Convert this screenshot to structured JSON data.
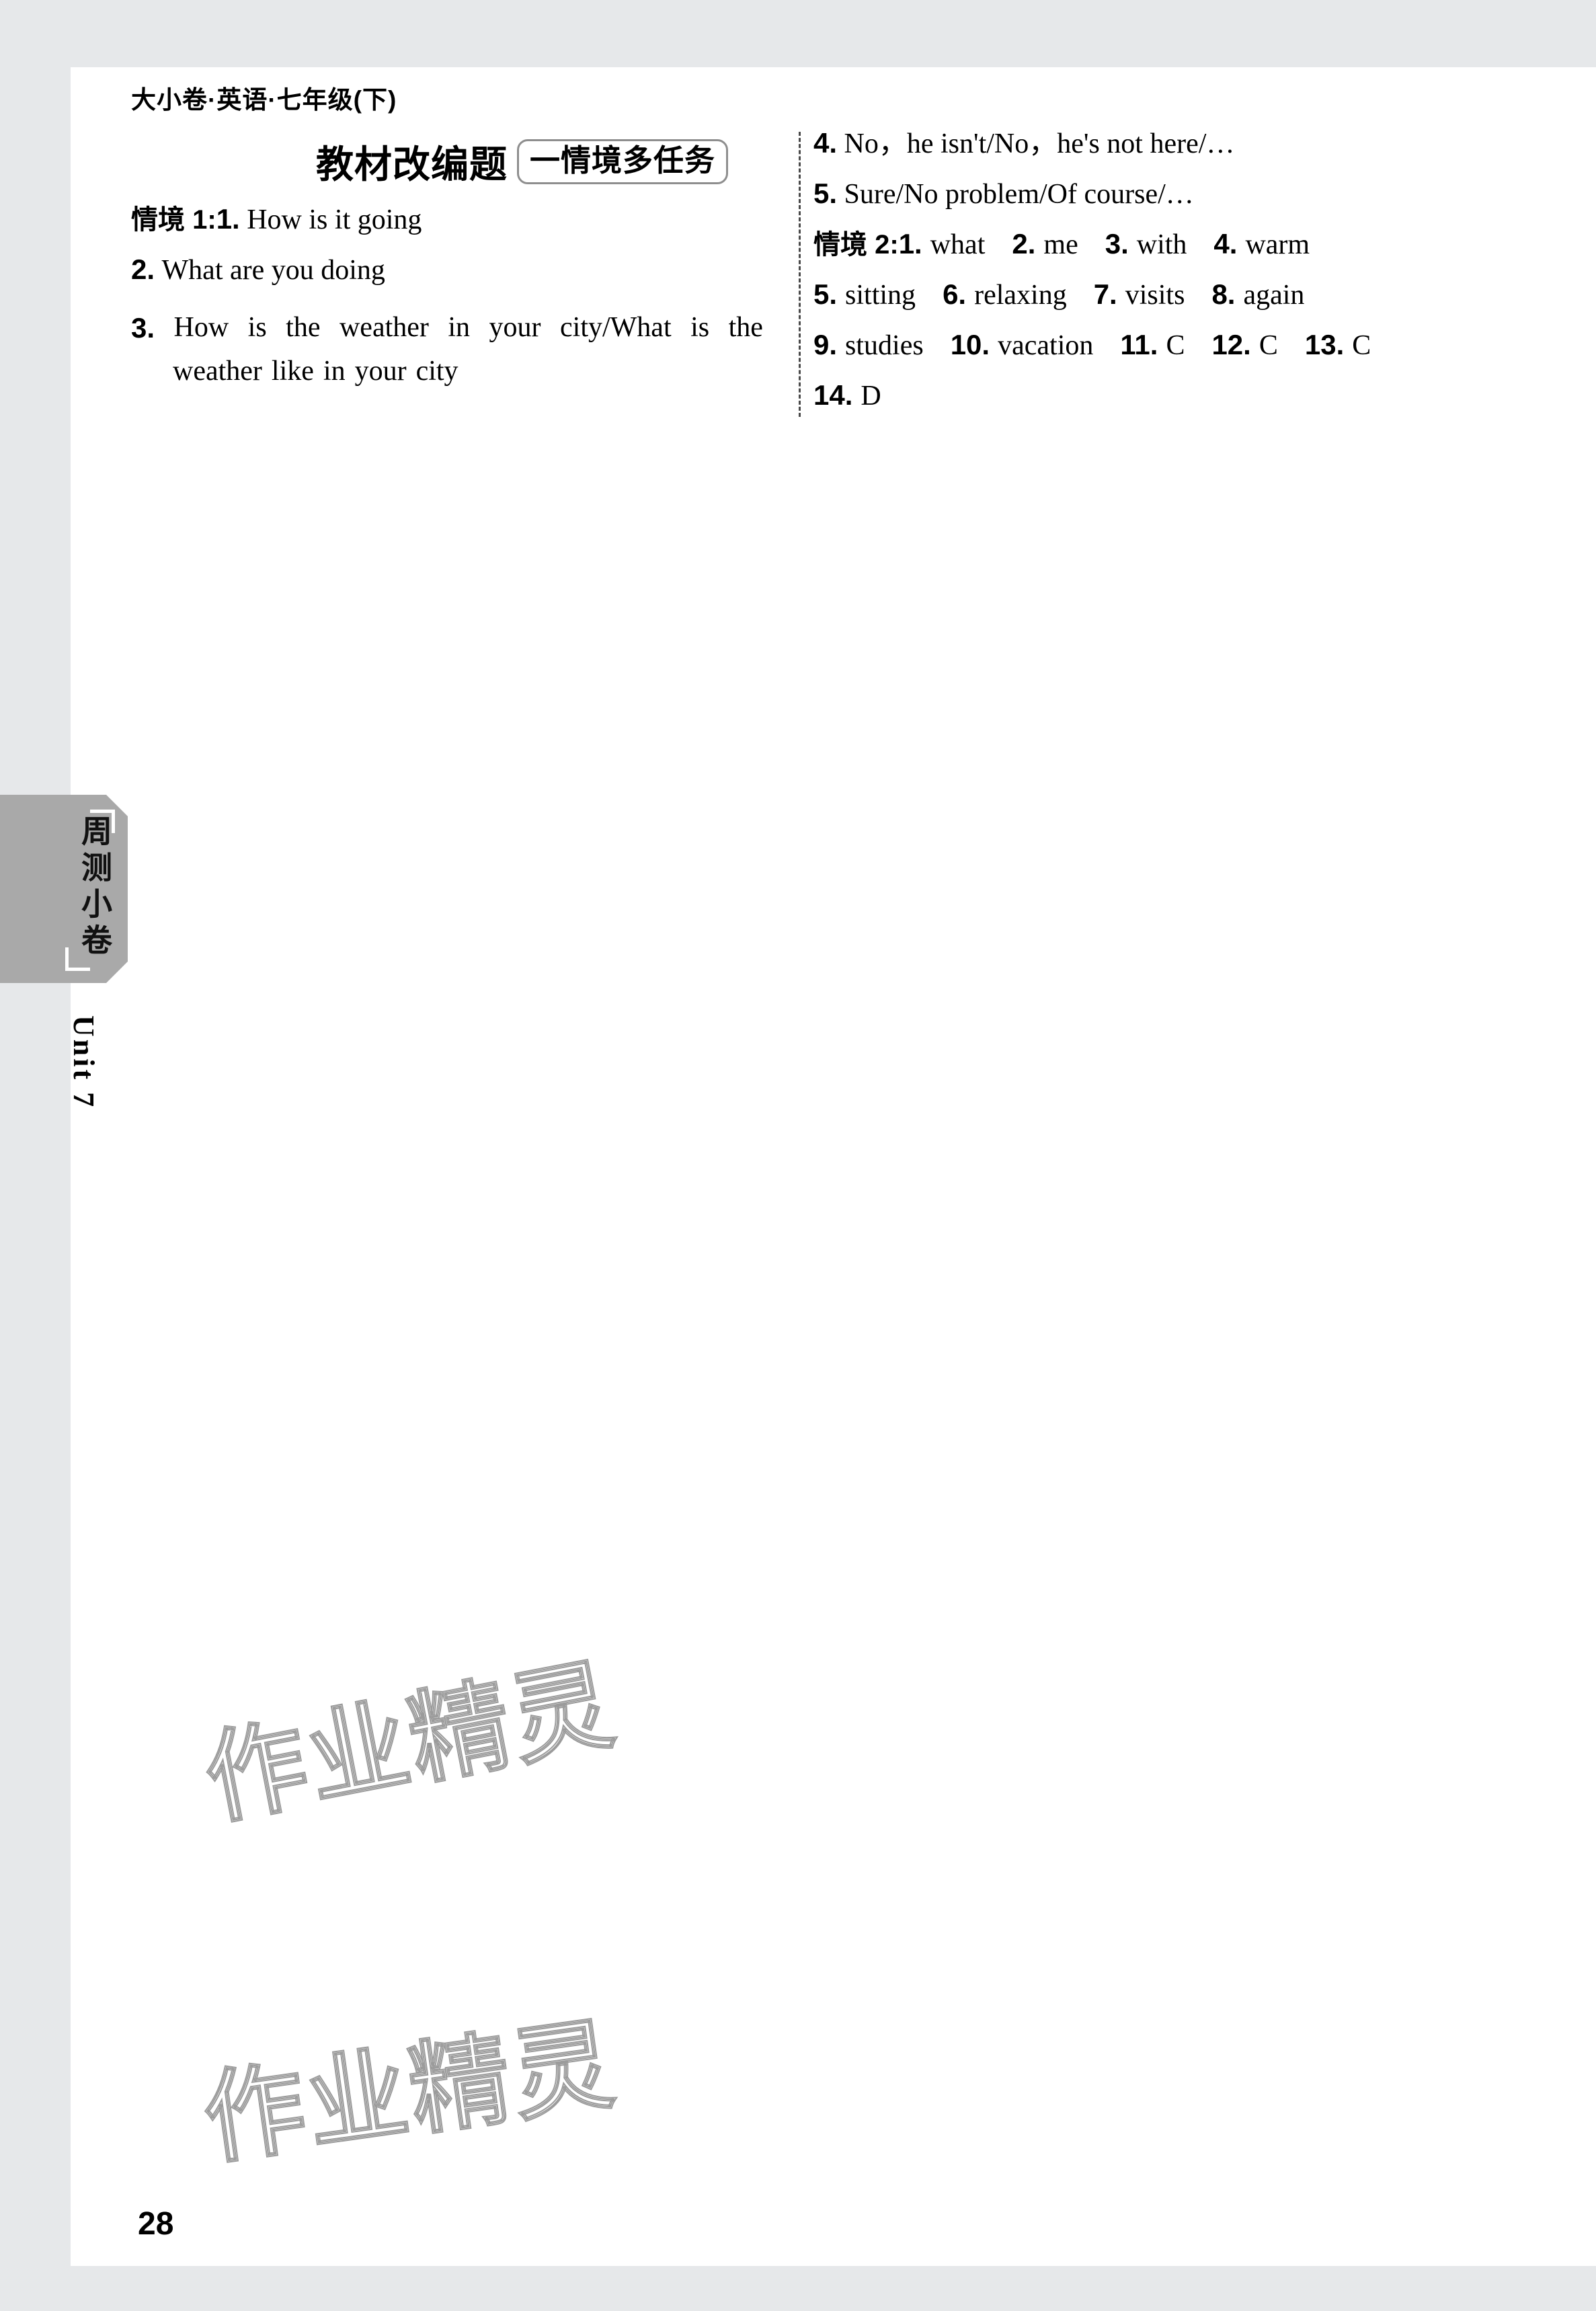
{
  "page": {
    "running_head": "大小卷·英语·七年级(下)",
    "folio": "28",
    "watermark": "作业精灵"
  },
  "side_tab": {
    "label": "周测小卷",
    "unit_label": "Unit 7"
  },
  "title": {
    "main": "教材改编题",
    "badge": "一情境多任务"
  },
  "answers": {
    "scene1": {
      "label": "情境 1:",
      "items": [
        {
          "num": "1.",
          "text": "How is it going"
        },
        {
          "num": "2.",
          "text": "What are you doing"
        },
        {
          "num": "3.",
          "text": "How is the weather in your city/What is the weather like in your city",
          "line1_words": [
            "How",
            "is",
            "the",
            "weather",
            "in",
            "your",
            "city/What",
            "is",
            "the"
          ],
          "line2_words": [
            "weather",
            "like",
            "in",
            "your",
            "city"
          ]
        },
        {
          "num": "4.",
          "text": "No，he isn't/No，he's not here/…"
        },
        {
          "num": "5.",
          "text": "Sure/No problem/Of course/…"
        }
      ]
    },
    "scene2": {
      "label": "情境 2:",
      "items": [
        {
          "num": "1.",
          "text": "what"
        },
        {
          "num": "2.",
          "text": "me"
        },
        {
          "num": "3.",
          "text": "with"
        },
        {
          "num": "4.",
          "text": "warm"
        },
        {
          "num": "5.",
          "text": "sitting"
        },
        {
          "num": "6.",
          "text": "relaxing"
        },
        {
          "num": "7.",
          "text": "visits"
        },
        {
          "num": "8.",
          "text": "again"
        },
        {
          "num": "9.",
          "text": "studies"
        },
        {
          "num": "10.",
          "text": "vacation"
        },
        {
          "num": "11.",
          "text": "C"
        },
        {
          "num": "12.",
          "text": "C"
        },
        {
          "num": "13.",
          "text": "C"
        },
        {
          "num": "14.",
          "text": "D"
        }
      ]
    }
  }
}
